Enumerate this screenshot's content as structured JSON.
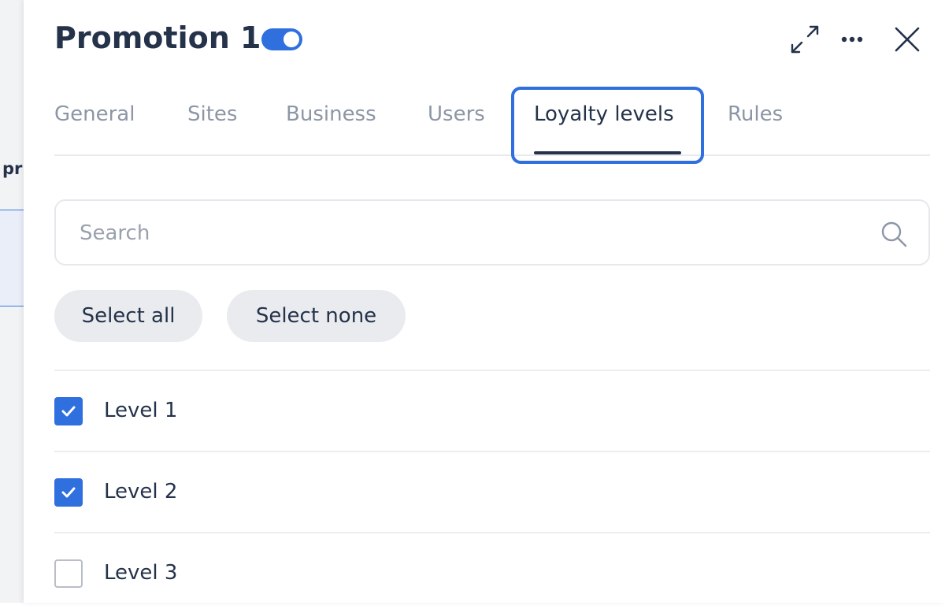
{
  "background": {
    "partial_heading": "pr"
  },
  "drawer": {
    "title": "Promotion 1",
    "enabled": true,
    "header_icons": [
      "expand-icon",
      "more-icon",
      "close-icon"
    ],
    "tabs": [
      {
        "label": "General",
        "active": false
      },
      {
        "label": "Sites",
        "active": false
      },
      {
        "label": "Business",
        "active": false
      },
      {
        "label": "Users",
        "active": false
      },
      {
        "label": "Loyalty levels",
        "active": true
      },
      {
        "label": "Rules",
        "active": false
      }
    ],
    "search": {
      "placeholder": "Search",
      "value": ""
    },
    "buttons": {
      "select_all": "Select all",
      "select_none": "Select none"
    },
    "levels": [
      {
        "label": "Level 1",
        "checked": true
      },
      {
        "label": "Level 2",
        "checked": true
      },
      {
        "label": "Level 3",
        "checked": false
      }
    ]
  },
  "colors": {
    "accent": "#2f6fde",
    "text": "#24324a",
    "muted": "#8d96a6",
    "pill_bg": "#e9ebee"
  }
}
